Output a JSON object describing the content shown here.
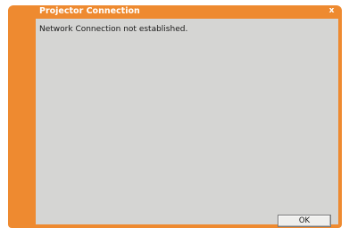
{
  "window": {
    "title": "Projector Connection",
    "close_glyph": "x",
    "accent_color": "#ee8a30",
    "client_color": "#d5d5d3"
  },
  "content": {
    "message": "Network Connection not established."
  },
  "buttons": {
    "ok_label": "OK"
  }
}
